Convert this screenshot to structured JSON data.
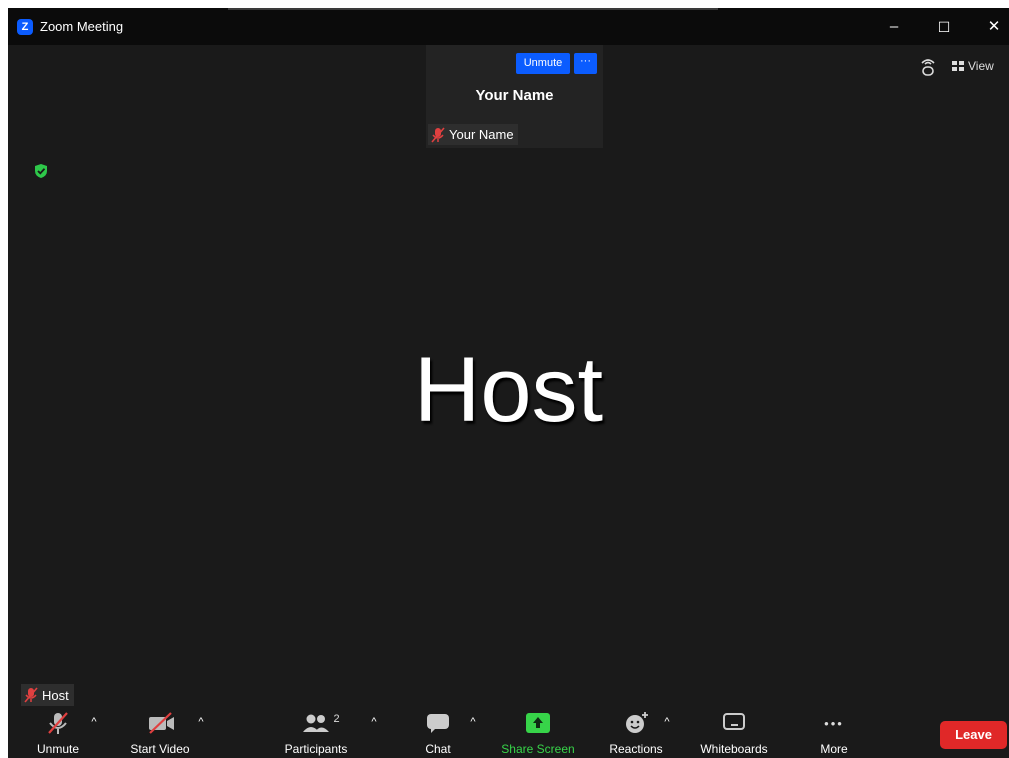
{
  "window": {
    "title": "Zoom Meeting",
    "logo_letter": "Z",
    "controls": {
      "minimize": "–",
      "maximize": "☐",
      "close": "✕"
    }
  },
  "self_tile": {
    "unmute_label": "Unmute",
    "more_label": "···",
    "display_name": "Your Name",
    "name_label": "Your Name",
    "icons": {
      "more": "ellipsis-icon",
      "muted": "mic-muted-icon"
    }
  },
  "top_right": {
    "view_label": "View",
    "icons": {
      "view": "grid-icon",
      "audio_ctrl": "audio-control-icon"
    }
  },
  "speaker": {
    "display_name": "Host",
    "name_label": "Host"
  },
  "toolbar": {
    "unmute": "Unmute",
    "start_video": "Start Video",
    "participants": "Participants",
    "participants_count": "2",
    "chat": "Chat",
    "share_screen": "Share Screen",
    "reactions": "Reactions",
    "whiteboards": "Whiteboards",
    "more": "More",
    "more_dots": "•••",
    "caret": "^",
    "leave": "Leave"
  },
  "colors": {
    "accent": "#0b5cff",
    "share": "#37d449",
    "leave": "#e02828",
    "muted": "#e04040",
    "shield": "#2ec84a"
  }
}
